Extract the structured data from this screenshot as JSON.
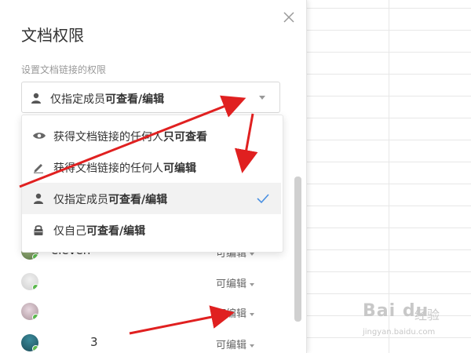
{
  "panel": {
    "title": "文档权限",
    "subtitle": "设置文档链接的权限",
    "select": {
      "value_prefix": "仅指定成员",
      "value_bold": "可查看/编辑",
      "icon": "person-icon"
    }
  },
  "menu": {
    "options": [
      {
        "prefix": "获得文档链接的任何人",
        "bold": "只可查看",
        "icon": "eye-icon",
        "selected": false
      },
      {
        "prefix": "获得文档链接的任何人",
        "bold": "可编辑",
        "icon": "pencil-icon",
        "selected": false
      },
      {
        "prefix": "仅指定成员",
        "bold": "可查看/编辑",
        "icon": "person-icon",
        "selected": true
      },
      {
        "prefix": "仅自己",
        "bold": "可查看/编辑",
        "icon": "lock-icon",
        "selected": false
      }
    ]
  },
  "members": [
    {
      "name": "eleven",
      "permission": "可编辑"
    },
    {
      "name": "",
      "permission": "可编辑"
    },
    {
      "name": "",
      "permission": "可编辑"
    },
    {
      "name": "3",
      "permission": "可编辑"
    }
  ],
  "watermark": {
    "logo": "Bai du",
    "sub": "经验",
    "url": "jingyan.baidu.com"
  },
  "colors": {
    "accent": "#4a90e2",
    "annotation_arrow": "#e02020",
    "online_dot": "#5bb84d"
  }
}
